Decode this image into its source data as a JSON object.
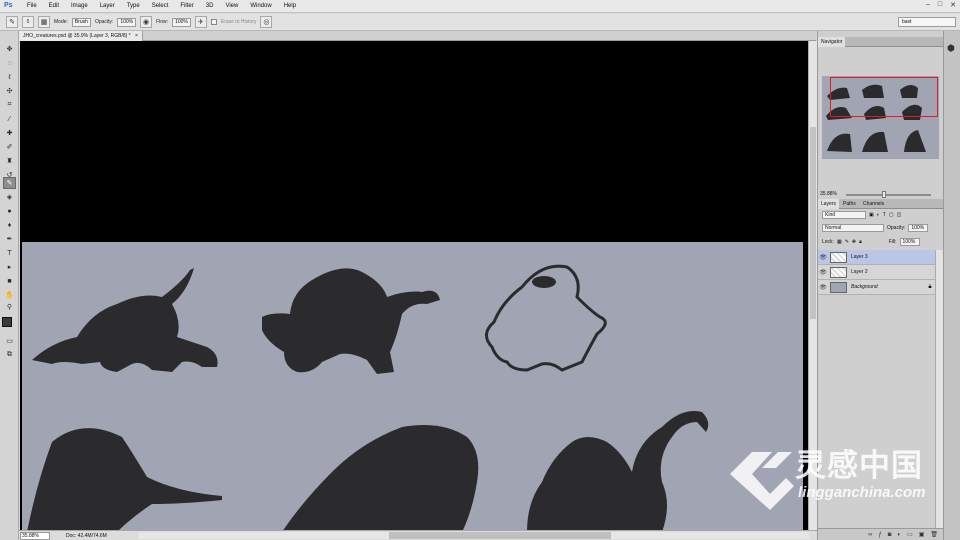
{
  "menubar": {
    "logo": "Ps",
    "items": [
      "File",
      "Edit",
      "Image",
      "Layer",
      "Type",
      "Select",
      "Filter",
      "3D",
      "View",
      "Window",
      "Help"
    ],
    "window_controls": [
      "–",
      "□",
      "✕"
    ]
  },
  "options": {
    "brush_size": "5",
    "mode_label": "Mode:",
    "mode_value": "Brush",
    "opacity_label": "Opacity:",
    "opacity_value": "100%",
    "flow_label": "Flow:",
    "flow_value": "100%",
    "erase_history": "Erase to History",
    "workspace": "bast"
  },
  "document": {
    "tab_title": "JHO_creatures.psd @ 35.9% (Layer 3, RGB/8) *",
    "close": "×"
  },
  "status": {
    "zoom": "35.88%",
    "doc": "Doc: 42.4M/74.6M"
  },
  "navigator": {
    "tab": "Navigator",
    "zoom": "35.88%"
  },
  "layers_panel": {
    "tabs": [
      "Layers",
      "Paths",
      "Channels"
    ],
    "filter_kind": "Kind",
    "blend_mode": "Normal",
    "opacity_label": "Opacity:",
    "opacity_value": "100%",
    "lock_label": "Lock:",
    "fill_label": "Fill:",
    "fill_value": "100%",
    "layers": [
      {
        "name": "Layer 3",
        "selected": true
      },
      {
        "name": "Layer 2",
        "selected": false
      },
      {
        "name": "Background",
        "selected": false,
        "locked": true
      }
    ]
  },
  "colors": {
    "canvas_bg": "#a1a4b3",
    "ink": "#2b2b2d",
    "selection": "#b9c6e6",
    "nav_frame": "#e01e1e"
  },
  "watermark": {
    "brand": "灵感中国",
    "url": "lingganchina.com"
  }
}
